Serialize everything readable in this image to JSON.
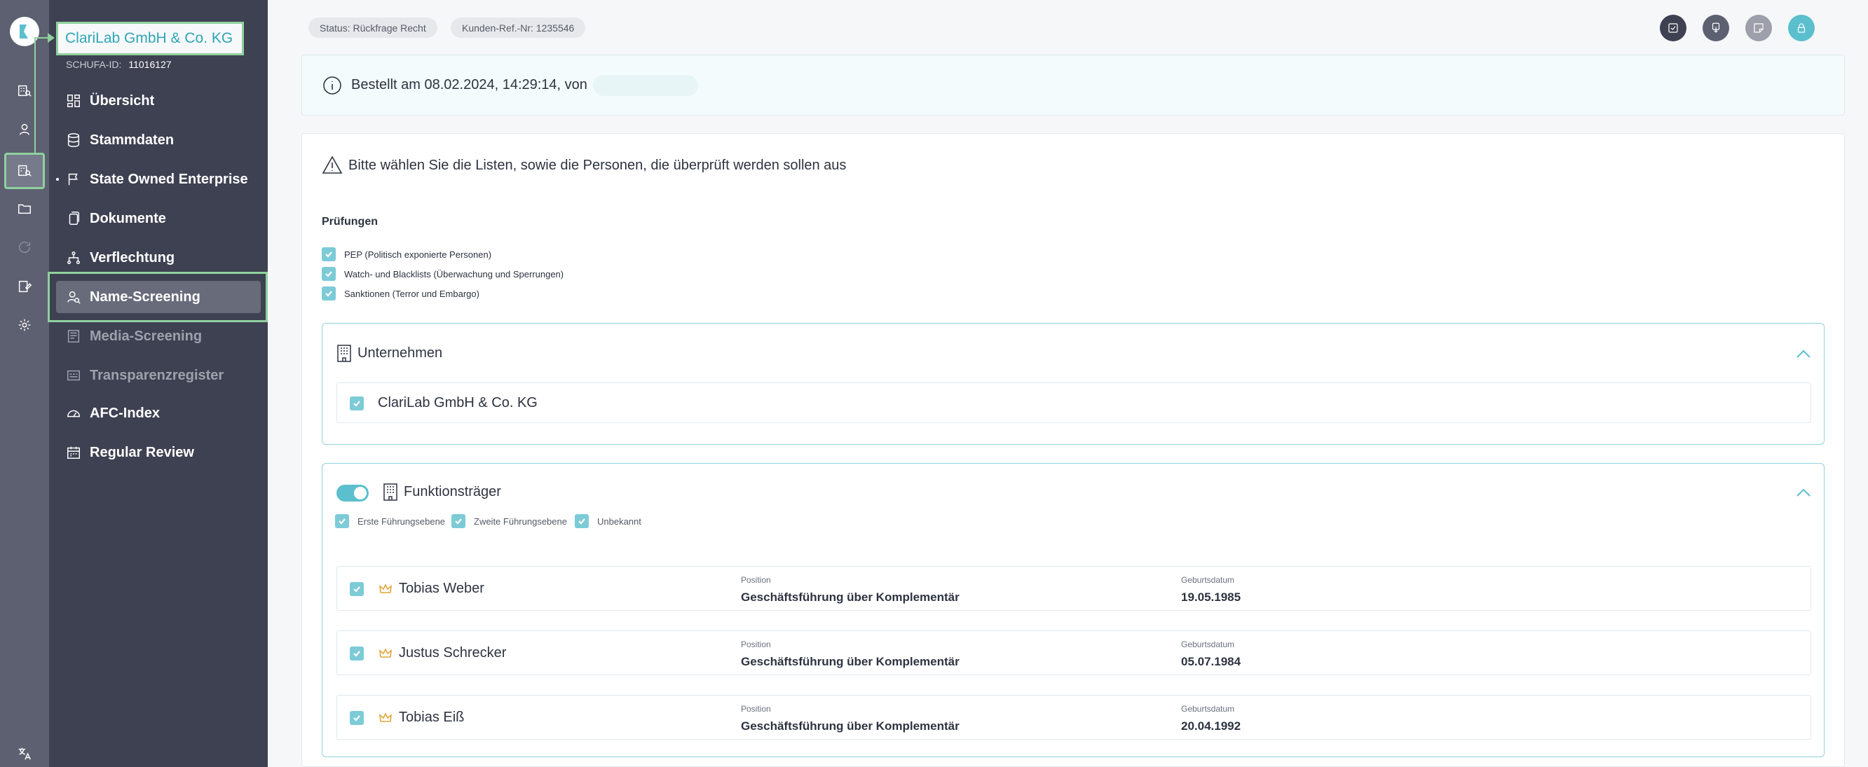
{
  "colors": {
    "accent": "#5bbfcd",
    "highlight": "#8fd19e",
    "sidebar": "#3e4152",
    "rail": "#5d6070",
    "crown": "#e0a63a"
  },
  "rail": {
    "icons": [
      "building-search-icon",
      "user-network-icon",
      "company-check-icon",
      "folder-icon",
      "refresh-icon",
      "signature-icon",
      "gear-icon"
    ],
    "bottom_icon": "translate-icon"
  },
  "sidebar": {
    "company_name": "ClariLab GmbH & Co. KG",
    "schufa_label": "SCHUFA-ID:",
    "schufa_id": "11016127",
    "items": [
      {
        "label": "Übersicht",
        "icon": "dashboard-icon",
        "state": "normal"
      },
      {
        "label": "Stammdaten",
        "icon": "database-icon",
        "state": "normal"
      },
      {
        "label": "State Owned Enterprise",
        "icon": "flag-icon",
        "state": "normal"
      },
      {
        "label": "Dokumente",
        "icon": "documents-icon",
        "state": "normal"
      },
      {
        "label": "Verflechtung",
        "icon": "hierarchy-icon",
        "state": "normal"
      },
      {
        "label": "Name-Screening",
        "icon": "user-search-icon",
        "state": "active"
      },
      {
        "label": "Media-Screening",
        "icon": "newspaper-icon",
        "state": "disabled"
      },
      {
        "label": "Transparenzregister",
        "icon": "register-icon",
        "state": "disabled"
      },
      {
        "label": "AFC-Index",
        "icon": "gauge-icon",
        "state": "normal"
      },
      {
        "label": "Regular Review",
        "icon": "calendar-icon",
        "state": "normal"
      }
    ]
  },
  "header": {
    "status": "Status: Rückfrage Recht",
    "ref": "Kunden-Ref.-Nr: 1235546",
    "actions": [
      "checklist-icon",
      "download-icon",
      "note-icon",
      "lock-icon"
    ]
  },
  "info": {
    "ordered": "Bestellt am 08.02.2024, 14:29:14, von"
  },
  "main": {
    "instruction": "Bitte wählen Sie die Listen, sowie die Personen, die überprüft werden sollen aus",
    "checks_title": "Prüfungen",
    "checks": [
      "PEP (Politisch exponierte Personen)",
      "Watch- und Blacklists (Überwachung und Sperrungen)",
      "Sanktionen (Terror und Embargo)"
    ],
    "company_section": {
      "title": "Unternehmen",
      "company": "ClariLab GmbH & Co. KG"
    },
    "officers_section": {
      "title": "Funktionsträger",
      "toggle_on": true,
      "levels": [
        "Erste Führungsebene",
        "Zweite Führungsebene",
        "Unbekannt"
      ],
      "position_label": "Position",
      "birth_label": "Geburtsdatum",
      "persons": [
        {
          "name": "Tobias Weber",
          "position": "Geschäftsführung über Komplementär",
          "birth": "19.05.1985"
        },
        {
          "name": "Justus Schrecker",
          "position": "Geschäftsführung über Komplementär",
          "birth": "05.07.1984"
        },
        {
          "name": "Tobias Eiß",
          "position": "Geschäftsführung über Komplementär",
          "birth": "20.04.1992"
        }
      ]
    }
  }
}
